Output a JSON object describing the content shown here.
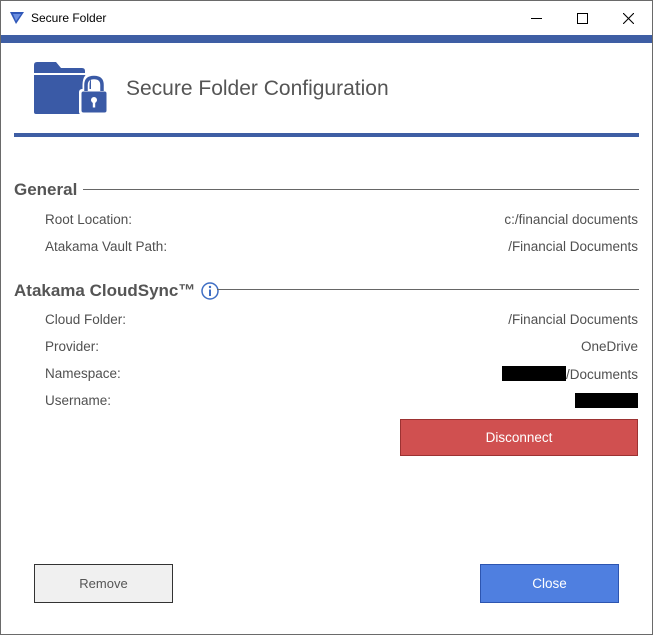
{
  "window": {
    "title": "Secure Folder",
    "accent_color": "#3e5ea4"
  },
  "header": {
    "title": "Secure Folder Configuration",
    "icon": "folder-lock-icon"
  },
  "general": {
    "heading": "General",
    "rows": [
      {
        "label": "Root Location:",
        "value": "c:/financial documents"
      },
      {
        "label": "Atakama Vault Path:",
        "value": "/Financial Documents"
      }
    ]
  },
  "cloudsync": {
    "heading": "Atakama CloudSync™",
    "info_icon": "info-icon",
    "rows": [
      {
        "label": "Cloud Folder:",
        "value": "/Financial Documents"
      },
      {
        "label": "Provider:",
        "value": "OneDrive"
      },
      {
        "label": "Namespace:",
        "value": "/Documents"
      },
      {
        "label": "Username:",
        "value": ""
      }
    ],
    "disconnect_label": "Disconnect",
    "disconnect_color": "#d05050"
  },
  "footer": {
    "remove_label": "Remove",
    "close_label": "Close",
    "close_color": "#4f7fe0"
  }
}
